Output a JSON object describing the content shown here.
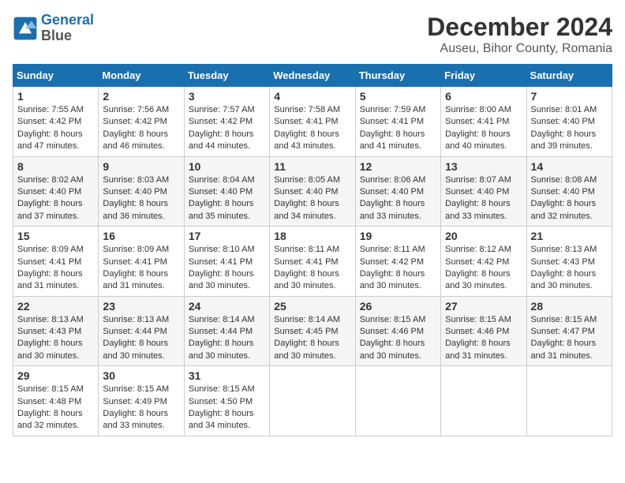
{
  "header": {
    "logo_line1": "General",
    "logo_line2": "Blue",
    "title": "December 2024",
    "subtitle": "Auseu, Bihor County, Romania"
  },
  "weekdays": [
    "Sunday",
    "Monday",
    "Tuesday",
    "Wednesday",
    "Thursday",
    "Friday",
    "Saturday"
  ],
  "weeks": [
    [
      {
        "day": "1",
        "sunrise": "Sunrise: 7:55 AM",
        "sunset": "Sunset: 4:42 PM",
        "daylight": "Daylight: 8 hours and 47 minutes."
      },
      {
        "day": "2",
        "sunrise": "Sunrise: 7:56 AM",
        "sunset": "Sunset: 4:42 PM",
        "daylight": "Daylight: 8 hours and 46 minutes."
      },
      {
        "day": "3",
        "sunrise": "Sunrise: 7:57 AM",
        "sunset": "Sunset: 4:42 PM",
        "daylight": "Daylight: 8 hours and 44 minutes."
      },
      {
        "day": "4",
        "sunrise": "Sunrise: 7:58 AM",
        "sunset": "Sunset: 4:41 PM",
        "daylight": "Daylight: 8 hours and 43 minutes."
      },
      {
        "day": "5",
        "sunrise": "Sunrise: 7:59 AM",
        "sunset": "Sunset: 4:41 PM",
        "daylight": "Daylight: 8 hours and 41 minutes."
      },
      {
        "day": "6",
        "sunrise": "Sunrise: 8:00 AM",
        "sunset": "Sunset: 4:41 PM",
        "daylight": "Daylight: 8 hours and 40 minutes."
      },
      {
        "day": "7",
        "sunrise": "Sunrise: 8:01 AM",
        "sunset": "Sunset: 4:40 PM",
        "daylight": "Daylight: 8 hours and 39 minutes."
      }
    ],
    [
      {
        "day": "8",
        "sunrise": "Sunrise: 8:02 AM",
        "sunset": "Sunset: 4:40 PM",
        "daylight": "Daylight: 8 hours and 37 minutes."
      },
      {
        "day": "9",
        "sunrise": "Sunrise: 8:03 AM",
        "sunset": "Sunset: 4:40 PM",
        "daylight": "Daylight: 8 hours and 36 minutes."
      },
      {
        "day": "10",
        "sunrise": "Sunrise: 8:04 AM",
        "sunset": "Sunset: 4:40 PM",
        "daylight": "Daylight: 8 hours and 35 minutes."
      },
      {
        "day": "11",
        "sunrise": "Sunrise: 8:05 AM",
        "sunset": "Sunset: 4:40 PM",
        "daylight": "Daylight: 8 hours and 34 minutes."
      },
      {
        "day": "12",
        "sunrise": "Sunrise: 8:06 AM",
        "sunset": "Sunset: 4:40 PM",
        "daylight": "Daylight: 8 hours and 33 minutes."
      },
      {
        "day": "13",
        "sunrise": "Sunrise: 8:07 AM",
        "sunset": "Sunset: 4:40 PM",
        "daylight": "Daylight: 8 hours and 33 minutes."
      },
      {
        "day": "14",
        "sunrise": "Sunrise: 8:08 AM",
        "sunset": "Sunset: 4:40 PM",
        "daylight": "Daylight: 8 hours and 32 minutes."
      }
    ],
    [
      {
        "day": "15",
        "sunrise": "Sunrise: 8:09 AM",
        "sunset": "Sunset: 4:41 PM",
        "daylight": "Daylight: 8 hours and 31 minutes."
      },
      {
        "day": "16",
        "sunrise": "Sunrise: 8:09 AM",
        "sunset": "Sunset: 4:41 PM",
        "daylight": "Daylight: 8 hours and 31 minutes."
      },
      {
        "day": "17",
        "sunrise": "Sunrise: 8:10 AM",
        "sunset": "Sunset: 4:41 PM",
        "daylight": "Daylight: 8 hours and 30 minutes."
      },
      {
        "day": "18",
        "sunrise": "Sunrise: 8:11 AM",
        "sunset": "Sunset: 4:41 PM",
        "daylight": "Daylight: 8 hours and 30 minutes."
      },
      {
        "day": "19",
        "sunrise": "Sunrise: 8:11 AM",
        "sunset": "Sunset: 4:42 PM",
        "daylight": "Daylight: 8 hours and 30 minutes."
      },
      {
        "day": "20",
        "sunrise": "Sunrise: 8:12 AM",
        "sunset": "Sunset: 4:42 PM",
        "daylight": "Daylight: 8 hours and 30 minutes."
      },
      {
        "day": "21",
        "sunrise": "Sunrise: 8:13 AM",
        "sunset": "Sunset: 4:43 PM",
        "daylight": "Daylight: 8 hours and 30 minutes."
      }
    ],
    [
      {
        "day": "22",
        "sunrise": "Sunrise: 8:13 AM",
        "sunset": "Sunset: 4:43 PM",
        "daylight": "Daylight: 8 hours and 30 minutes."
      },
      {
        "day": "23",
        "sunrise": "Sunrise: 8:13 AM",
        "sunset": "Sunset: 4:44 PM",
        "daylight": "Daylight: 8 hours and 30 minutes."
      },
      {
        "day": "24",
        "sunrise": "Sunrise: 8:14 AM",
        "sunset": "Sunset: 4:44 PM",
        "daylight": "Daylight: 8 hours and 30 minutes."
      },
      {
        "day": "25",
        "sunrise": "Sunrise: 8:14 AM",
        "sunset": "Sunset: 4:45 PM",
        "daylight": "Daylight: 8 hours and 30 minutes."
      },
      {
        "day": "26",
        "sunrise": "Sunrise: 8:15 AM",
        "sunset": "Sunset: 4:46 PM",
        "daylight": "Daylight: 8 hours and 30 minutes."
      },
      {
        "day": "27",
        "sunrise": "Sunrise: 8:15 AM",
        "sunset": "Sunset: 4:46 PM",
        "daylight": "Daylight: 8 hours and 31 minutes."
      },
      {
        "day": "28",
        "sunrise": "Sunrise: 8:15 AM",
        "sunset": "Sunset: 4:47 PM",
        "daylight": "Daylight: 8 hours and 31 minutes."
      }
    ],
    [
      {
        "day": "29",
        "sunrise": "Sunrise: 8:15 AM",
        "sunset": "Sunset: 4:48 PM",
        "daylight": "Daylight: 8 hours and 32 minutes."
      },
      {
        "day": "30",
        "sunrise": "Sunrise: 8:15 AM",
        "sunset": "Sunset: 4:49 PM",
        "daylight": "Daylight: 8 hours and 33 minutes."
      },
      {
        "day": "31",
        "sunrise": "Sunrise: 8:15 AM",
        "sunset": "Sunset: 4:50 PM",
        "daylight": "Daylight: 8 hours and 34 minutes."
      },
      null,
      null,
      null,
      null
    ]
  ]
}
